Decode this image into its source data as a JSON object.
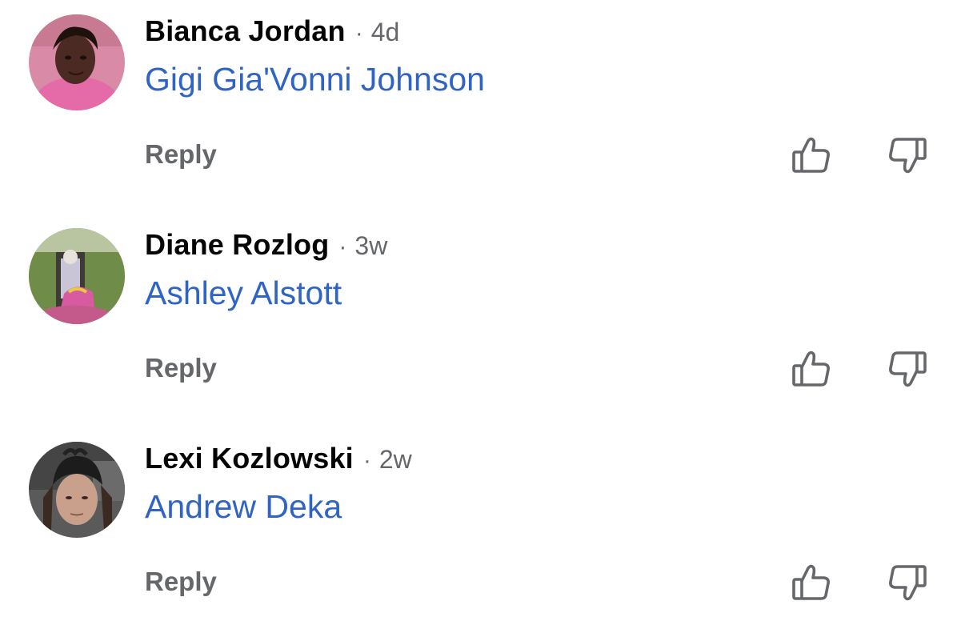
{
  "comments": [
    {
      "author": "Bianca Jordan",
      "separator": "·",
      "time": "4d",
      "mention": "Gigi Gia'Vonni Johnson",
      "reply_label": "Reply",
      "like_icon": "thumbs-up-icon",
      "dislike_icon": "thumbs-down-icon"
    },
    {
      "author": "Diane Rozlog",
      "separator": "·",
      "time": "3w",
      "mention": "Ashley Alstott",
      "reply_label": "Reply",
      "like_icon": "thumbs-up-icon",
      "dislike_icon": "thumbs-down-icon"
    },
    {
      "author": "Lexi Kozlowski",
      "separator": "·",
      "time": "2w",
      "mention": "Andrew Deka",
      "reply_label": "Reply",
      "like_icon": "thumbs-up-icon",
      "dislike_icon": "thumbs-down-icon"
    }
  ],
  "colors": {
    "author": "#050505",
    "meta": "#65676b",
    "mention_link": "#2f64c4",
    "icon_stroke": "#65676b"
  }
}
